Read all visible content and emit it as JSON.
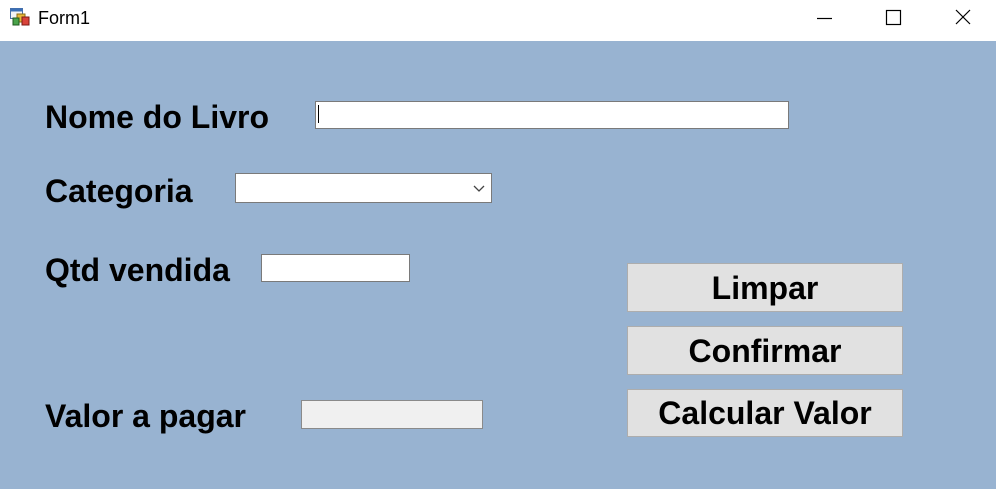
{
  "window": {
    "title": "Form1",
    "background": "#98b3d1",
    "titlebar_controls": [
      "minimize-icon",
      "maximize-icon",
      "close-icon"
    ]
  },
  "form": {
    "book_name": {
      "label": "Nome do Livro",
      "value": ""
    },
    "category": {
      "label": "Categoria",
      "selected": ""
    },
    "quantity_sold": {
      "label": "Qtd vendida",
      "value": ""
    },
    "amount_to_pay": {
      "label": "Valor a pagar",
      "value": ""
    }
  },
  "buttons": {
    "clear": "Limpar",
    "confirm": "Confirmar",
    "calculate": "Calcular Valor"
  }
}
